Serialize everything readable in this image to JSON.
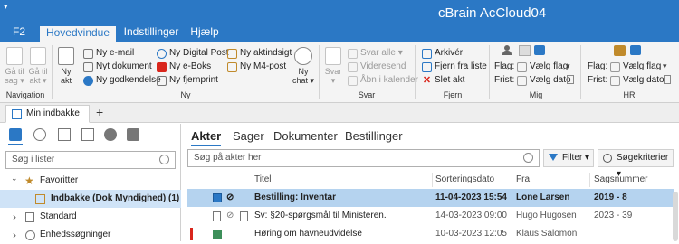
{
  "window": {
    "title": "cBrain AcCloud04"
  },
  "ribbon_tabs": [
    "F2",
    "Hovedvindue",
    "Indstillinger",
    "Hjælp"
  ],
  "ribbon_active_tab": "Hovedvindue",
  "navigation": {
    "group_label": "Navigation",
    "back": "Gå til\nsag",
    "back_caret": "▾",
    "fwd": "Gå til\nakt",
    "fwd_caret": "▾"
  },
  "ny": {
    "group_label": "Ny",
    "big_button": "Ny\nakt",
    "items": [
      "Ny e-mail",
      "Nyt dokument",
      "Ny godkendelse",
      "Ny Digital Post",
      "Ny e-Boks",
      "Ny fjernprint",
      "Ny aktindsigt",
      "Ny M4-post"
    ],
    "chat": "Ny\nchat",
    "chat_caret": "▾"
  },
  "svar": {
    "group_label": "Svar",
    "big_button": "Svar",
    "big_caret": "▾",
    "items": [
      "Svar alle",
      "Videresend",
      "Åbn i kalender"
    ],
    "svar_alle_caret": "▾"
  },
  "fjern": {
    "group_label": "Fjern",
    "items": [
      "Arkivér",
      "Fjern fra liste",
      "Slet akt"
    ]
  },
  "mig": {
    "group_label": "Mig",
    "flag_label": "Flag:",
    "flag_value": "Vælg flag",
    "frist_label": "Frist:",
    "frist_value": "Vælg dato"
  },
  "hr": {
    "group_label": "HR",
    "flag_label": "Flag:",
    "flag_value": "Vælg flag",
    "frist_label": "Frist:",
    "frist_value": "Vælg dato"
  },
  "document_tab": {
    "label": "Min indbakke (1)",
    "add": "+"
  },
  "left": {
    "search_placeholder": "Søg i lister",
    "tree": [
      {
        "label": "Favoritter",
        "chev": "⌄"
      },
      {
        "label": "Indbakke (Dok Myndighed) (1)"
      },
      {
        "label": "Standard",
        "chev": "›"
      },
      {
        "label": "Enhedssøgninger",
        "chev": "›"
      }
    ]
  },
  "content_tabs": [
    "Akter",
    "Sager",
    "Dokumenter",
    "Bestillinger"
  ],
  "content_active_tab": "Akter",
  "content_search_placeholder": "Søg på akter her",
  "filter_label": "Filter",
  "filter_caret": "▾",
  "search_criteria_label": "Søgekriterier",
  "search_criteria_caret": "▾",
  "columns": [
    "Titel",
    "Sorteringsdato",
    "Fra",
    "Sagsnummer"
  ],
  "rows": [
    {
      "title": "Bestilling: Inventar",
      "date": "11-04-2023 15:54",
      "from": "Lone Larsen",
      "case": "2019 - 8",
      "selected": true
    },
    {
      "title": "Sv: §20-spørgsmål til Ministeren.",
      "date": "14-03-2023 09:00",
      "from": "Hugo Hugosen",
      "case": "2023 - 39",
      "selected": false
    },
    {
      "title": "Høring om havneudvidelse",
      "date": "10-03-2023 12:05",
      "from": "Klaus Salomon",
      "case": "",
      "selected": false
    }
  ],
  "colors": {
    "accent": "#2b78c5",
    "selection": "#b5d3ef",
    "tree_selection": "#cfe3f7",
    "red_marker": "#d9261c"
  }
}
